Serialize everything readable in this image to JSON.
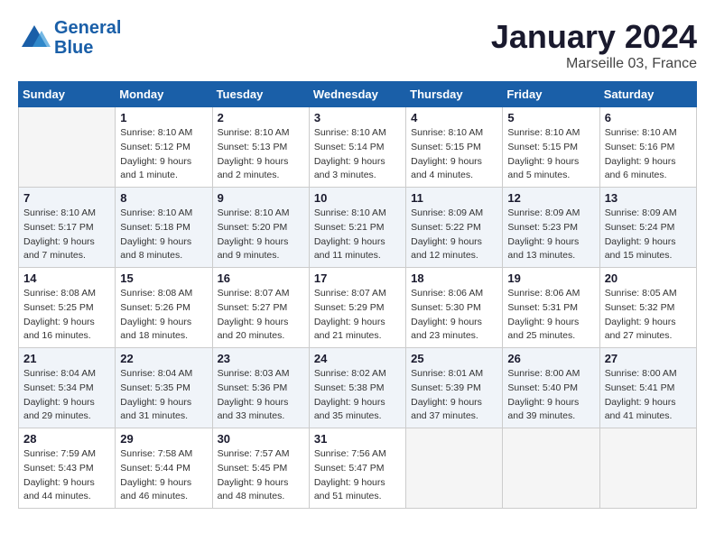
{
  "header": {
    "logo_line1": "General",
    "logo_line2": "Blue",
    "month": "January 2024",
    "location": "Marseille 03, France"
  },
  "weekdays": [
    "Sunday",
    "Monday",
    "Tuesday",
    "Wednesday",
    "Thursday",
    "Friday",
    "Saturday"
  ],
  "weeks": [
    [
      {
        "day": "",
        "sunrise": "",
        "sunset": "",
        "daylight": ""
      },
      {
        "day": "1",
        "sunrise": "Sunrise: 8:10 AM",
        "sunset": "Sunset: 5:12 PM",
        "daylight": "Daylight: 9 hours and 1 minute."
      },
      {
        "day": "2",
        "sunrise": "Sunrise: 8:10 AM",
        "sunset": "Sunset: 5:13 PM",
        "daylight": "Daylight: 9 hours and 2 minutes."
      },
      {
        "day": "3",
        "sunrise": "Sunrise: 8:10 AM",
        "sunset": "Sunset: 5:14 PM",
        "daylight": "Daylight: 9 hours and 3 minutes."
      },
      {
        "day": "4",
        "sunrise": "Sunrise: 8:10 AM",
        "sunset": "Sunset: 5:15 PM",
        "daylight": "Daylight: 9 hours and 4 minutes."
      },
      {
        "day": "5",
        "sunrise": "Sunrise: 8:10 AM",
        "sunset": "Sunset: 5:15 PM",
        "daylight": "Daylight: 9 hours and 5 minutes."
      },
      {
        "day": "6",
        "sunrise": "Sunrise: 8:10 AM",
        "sunset": "Sunset: 5:16 PM",
        "daylight": "Daylight: 9 hours and 6 minutes."
      }
    ],
    [
      {
        "day": "7",
        "sunrise": "Sunrise: 8:10 AM",
        "sunset": "Sunset: 5:17 PM",
        "daylight": "Daylight: 9 hours and 7 minutes."
      },
      {
        "day": "8",
        "sunrise": "Sunrise: 8:10 AM",
        "sunset": "Sunset: 5:18 PM",
        "daylight": "Daylight: 9 hours and 8 minutes."
      },
      {
        "day": "9",
        "sunrise": "Sunrise: 8:10 AM",
        "sunset": "Sunset: 5:20 PM",
        "daylight": "Daylight: 9 hours and 9 minutes."
      },
      {
        "day": "10",
        "sunrise": "Sunrise: 8:10 AM",
        "sunset": "Sunset: 5:21 PM",
        "daylight": "Daylight: 9 hours and 11 minutes."
      },
      {
        "day": "11",
        "sunrise": "Sunrise: 8:09 AM",
        "sunset": "Sunset: 5:22 PM",
        "daylight": "Daylight: 9 hours and 12 minutes."
      },
      {
        "day": "12",
        "sunrise": "Sunrise: 8:09 AM",
        "sunset": "Sunset: 5:23 PM",
        "daylight": "Daylight: 9 hours and 13 minutes."
      },
      {
        "day": "13",
        "sunrise": "Sunrise: 8:09 AM",
        "sunset": "Sunset: 5:24 PM",
        "daylight": "Daylight: 9 hours and 15 minutes."
      }
    ],
    [
      {
        "day": "14",
        "sunrise": "Sunrise: 8:08 AM",
        "sunset": "Sunset: 5:25 PM",
        "daylight": "Daylight: 9 hours and 16 minutes."
      },
      {
        "day": "15",
        "sunrise": "Sunrise: 8:08 AM",
        "sunset": "Sunset: 5:26 PM",
        "daylight": "Daylight: 9 hours and 18 minutes."
      },
      {
        "day": "16",
        "sunrise": "Sunrise: 8:07 AM",
        "sunset": "Sunset: 5:27 PM",
        "daylight": "Daylight: 9 hours and 20 minutes."
      },
      {
        "day": "17",
        "sunrise": "Sunrise: 8:07 AM",
        "sunset": "Sunset: 5:29 PM",
        "daylight": "Daylight: 9 hours and 21 minutes."
      },
      {
        "day": "18",
        "sunrise": "Sunrise: 8:06 AM",
        "sunset": "Sunset: 5:30 PM",
        "daylight": "Daylight: 9 hours and 23 minutes."
      },
      {
        "day": "19",
        "sunrise": "Sunrise: 8:06 AM",
        "sunset": "Sunset: 5:31 PM",
        "daylight": "Daylight: 9 hours and 25 minutes."
      },
      {
        "day": "20",
        "sunrise": "Sunrise: 8:05 AM",
        "sunset": "Sunset: 5:32 PM",
        "daylight": "Daylight: 9 hours and 27 minutes."
      }
    ],
    [
      {
        "day": "21",
        "sunrise": "Sunrise: 8:04 AM",
        "sunset": "Sunset: 5:34 PM",
        "daylight": "Daylight: 9 hours and 29 minutes."
      },
      {
        "day": "22",
        "sunrise": "Sunrise: 8:04 AM",
        "sunset": "Sunset: 5:35 PM",
        "daylight": "Daylight: 9 hours and 31 minutes."
      },
      {
        "day": "23",
        "sunrise": "Sunrise: 8:03 AM",
        "sunset": "Sunset: 5:36 PM",
        "daylight": "Daylight: 9 hours and 33 minutes."
      },
      {
        "day": "24",
        "sunrise": "Sunrise: 8:02 AM",
        "sunset": "Sunset: 5:38 PM",
        "daylight": "Daylight: 9 hours and 35 minutes."
      },
      {
        "day": "25",
        "sunrise": "Sunrise: 8:01 AM",
        "sunset": "Sunset: 5:39 PM",
        "daylight": "Daylight: 9 hours and 37 minutes."
      },
      {
        "day": "26",
        "sunrise": "Sunrise: 8:00 AM",
        "sunset": "Sunset: 5:40 PM",
        "daylight": "Daylight: 9 hours and 39 minutes."
      },
      {
        "day": "27",
        "sunrise": "Sunrise: 8:00 AM",
        "sunset": "Sunset: 5:41 PM",
        "daylight": "Daylight: 9 hours and 41 minutes."
      }
    ],
    [
      {
        "day": "28",
        "sunrise": "Sunrise: 7:59 AM",
        "sunset": "Sunset: 5:43 PM",
        "daylight": "Daylight: 9 hours and 44 minutes."
      },
      {
        "day": "29",
        "sunrise": "Sunrise: 7:58 AM",
        "sunset": "Sunset: 5:44 PM",
        "daylight": "Daylight: 9 hours and 46 minutes."
      },
      {
        "day": "30",
        "sunrise": "Sunrise: 7:57 AM",
        "sunset": "Sunset: 5:45 PM",
        "daylight": "Daylight: 9 hours and 48 minutes."
      },
      {
        "day": "31",
        "sunrise": "Sunrise: 7:56 AM",
        "sunset": "Sunset: 5:47 PM",
        "daylight": "Daylight: 9 hours and 51 minutes."
      },
      {
        "day": "",
        "sunrise": "",
        "sunset": "",
        "daylight": ""
      },
      {
        "day": "",
        "sunrise": "",
        "sunset": "",
        "daylight": ""
      },
      {
        "day": "",
        "sunrise": "",
        "sunset": "",
        "daylight": ""
      }
    ]
  ]
}
